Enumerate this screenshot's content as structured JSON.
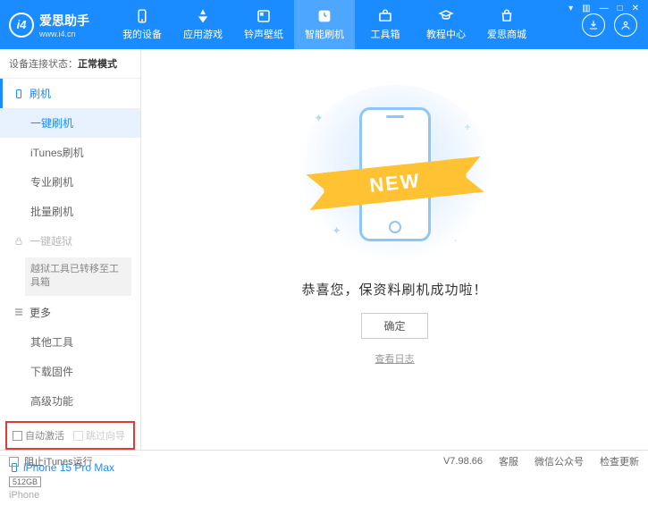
{
  "app": {
    "name": "爱思助手",
    "url": "www.i4.cn"
  },
  "nav": {
    "items": [
      {
        "label": "我的设备"
      },
      {
        "label": "应用游戏"
      },
      {
        "label": "铃声壁纸"
      },
      {
        "label": "智能刷机"
      },
      {
        "label": "工具箱"
      },
      {
        "label": "教程中心"
      },
      {
        "label": "爱思商城"
      }
    ],
    "active_index": 3
  },
  "sidebar": {
    "status_label": "设备连接状态：",
    "status_value": "正常模式",
    "flash": {
      "head": "刷机",
      "items": [
        "一键刷机",
        "iTunes刷机",
        "专业刷机",
        "批量刷机"
      ],
      "active_index": 0
    },
    "jailbreak": {
      "head": "一键越狱",
      "note": "越狱工具已转移至工具箱"
    },
    "more": {
      "head": "更多",
      "items": [
        "其他工具",
        "下载固件",
        "高级功能"
      ]
    },
    "opts": {
      "auto_activate": "自动激活",
      "skip_setup": "跳过向导"
    },
    "device": {
      "name": "iPhone 15 Pro Max",
      "storage": "512GB",
      "type": "iPhone"
    }
  },
  "main": {
    "ribbon": "NEW",
    "message": "恭喜您，保资料刷机成功啦！",
    "ok": "确定",
    "log_link": "查看日志"
  },
  "statusbar": {
    "block_itunes": "阻止iTunes运行",
    "version": "V7.98.66",
    "items": [
      "客服",
      "微信公众号",
      "检查更新"
    ]
  }
}
